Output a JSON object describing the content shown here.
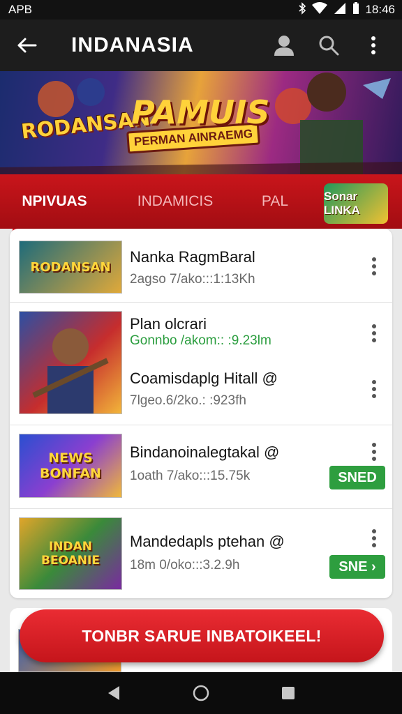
{
  "status_bar": {
    "carrier": "APB",
    "time": "18:46"
  },
  "app_bar": {
    "title": "INDANASIA"
  },
  "banner": {
    "left_text": "RODANSAN",
    "main_text": "PAMUIS",
    "sub_text": "PERMAN AINRAEMG"
  },
  "tabs": [
    {
      "label": "NPIVUAS",
      "active": true
    },
    {
      "label": "INDAMICIS",
      "active": false
    },
    {
      "label": "PAL",
      "active": false
    }
  ],
  "tab_logo": {
    "text": "Sonar LINKA"
  },
  "list": [
    {
      "title": "Nanka RagmBaral",
      "meta": "2agso 7/ako:::1:13Kh",
      "meta_color": "gray",
      "thumb_text": "RODANSAN",
      "badge": null
    },
    {
      "title": "Plan olcrari",
      "meta": "Gonnbo /akom:: :9.23lm",
      "meta_color": "green",
      "thumb_text": "",
      "badge": null
    },
    {
      "title": "Coamisdaplg Hitall  @",
      "meta": "7lgeo.6/2ko.: :923fh",
      "meta_color": "gray",
      "thumb_text": "",
      "badge": null
    },
    {
      "title": "Bindanoinalegtakal  @",
      "meta": "1oath 7/ako:::15.75k",
      "meta_color": "gray",
      "thumb_text": "NEWS BONFAN",
      "badge": "SNED"
    },
    {
      "title": "Mandedapls ptehan  @",
      "meta": "18m 0/oko:::3.2.9h",
      "meta_color": "gray",
      "thumb_text": "INDAN BEOANIE",
      "badge": "SNE ›"
    }
  ],
  "cta": {
    "label": "TONBR SARUE INBATOIKEEL!"
  },
  "colors": {
    "accent": "#c9151b",
    "green": "#2e9e3f"
  }
}
